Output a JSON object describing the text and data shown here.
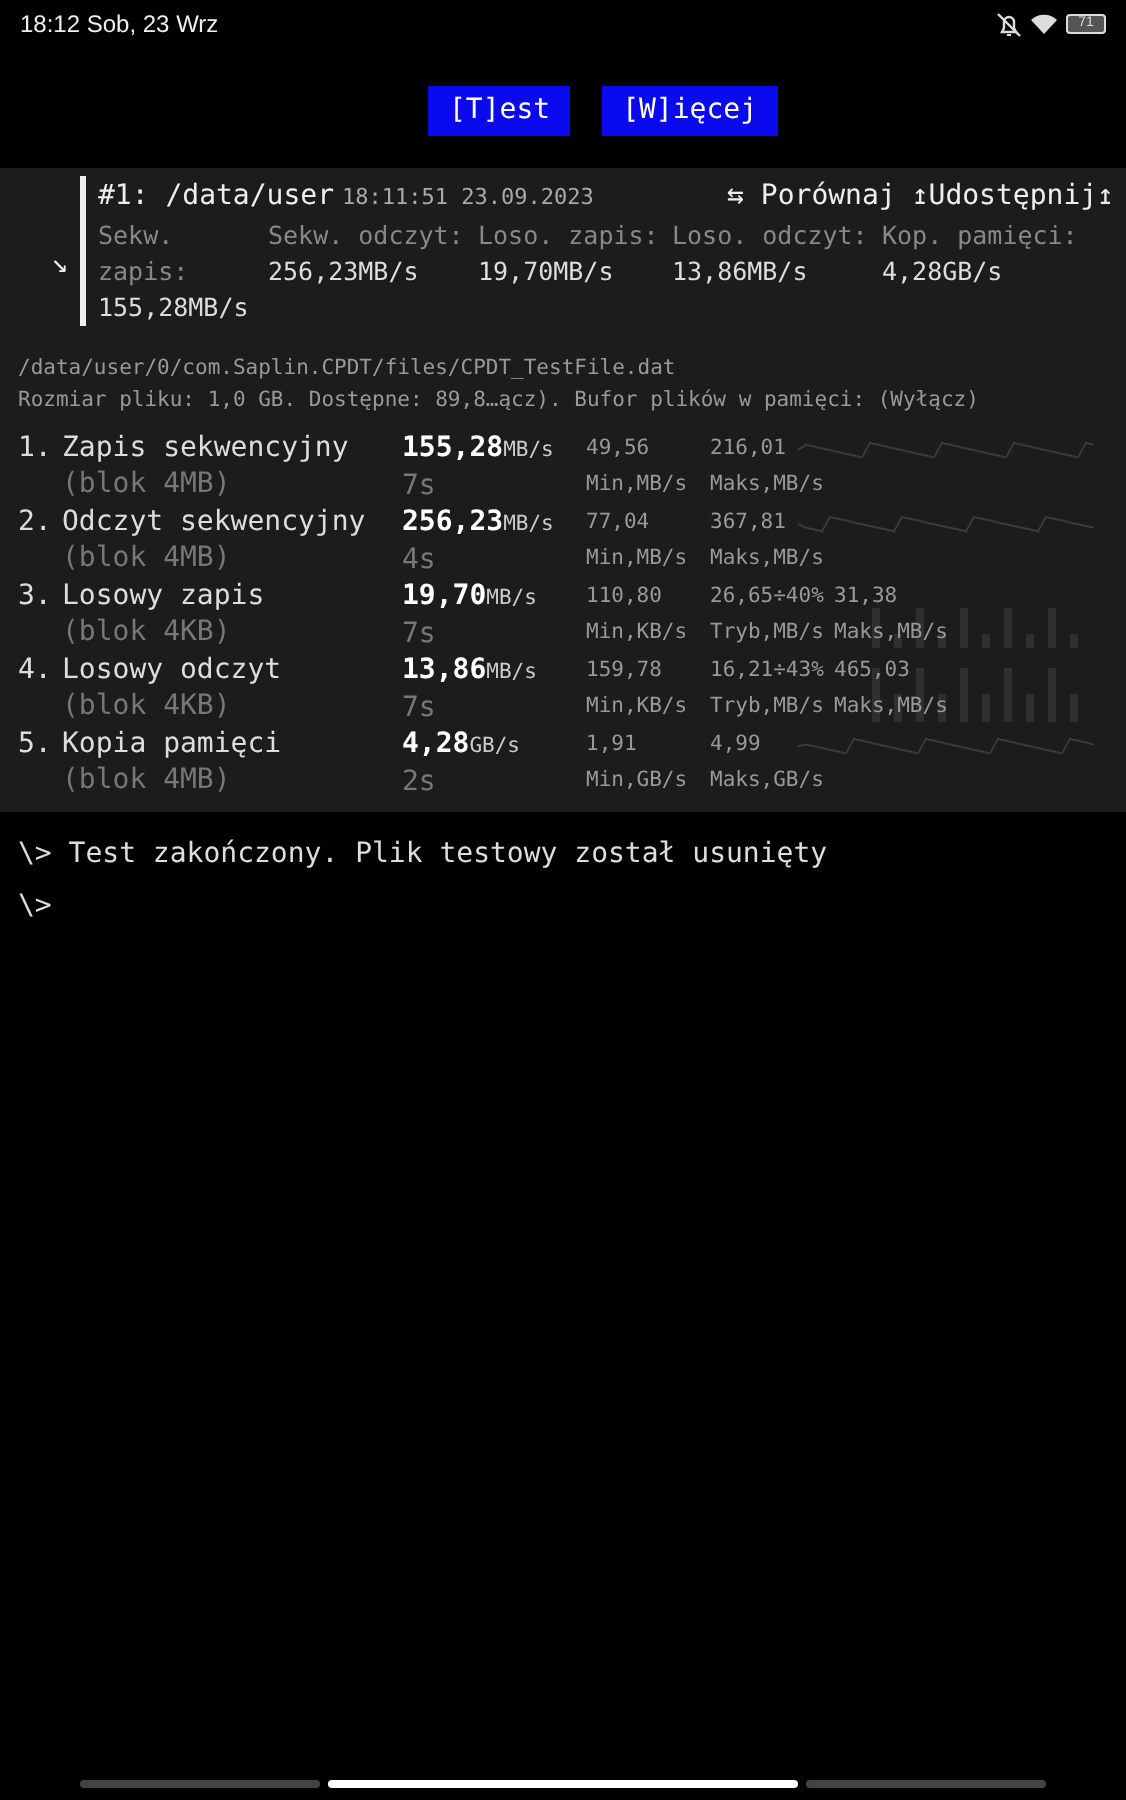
{
  "status_bar": {
    "time": "18:12 Sob, 23 Wrz",
    "battery": "71"
  },
  "buttons": [
    "[T]est",
    "[W]ięcej"
  ],
  "result": {
    "expand": "↘",
    "title": "#1: /data/user",
    "timestamp": "18:11:51 23.09.2023",
    "compare": "⇆ Porównaj",
    "share": "↥Udostępnij↥",
    "metrics": [
      {
        "label": "Sekw. zapis:",
        "value": "155,28MB/s"
      },
      {
        "label": "Sekw. odczyt:",
        "value": "256,23MB/s"
      },
      {
        "label": "Loso. zapis:",
        "value": "19,70MB/s"
      },
      {
        "label": "Loso. odczyt:",
        "value": "13,86MB/s"
      },
      {
        "label": "Kop. pamięci:",
        "value": "4,28GB/s"
      }
    ]
  },
  "file_path": "/data/user/0/com.Saplin.CPDT/files/CPDT_TestFile.dat",
  "file_info": "Rozmiar pliku: 1,0 GB. Dostępne: 89,8…ącz). Bufor plików w pamięci: (Wyłącz)",
  "tests": [
    {
      "number": "1.",
      "name": "Zapis sekwencyjny",
      "block": "(blok 4MB)",
      "speed": "155,28",
      "unit": "MB/s",
      "time": "7s",
      "kind": "line",
      "stats": [
        {
          "value": "49,56",
          "label": "Min,MB/s"
        },
        {
          "value": "216,01",
          "label": "Maks,MB/s"
        }
      ]
    },
    {
      "number": "2.",
      "name": "Odczyt sekwencyjny",
      "block": "(blok 4MB)",
      "speed": "256,23",
      "unit": "MB/s",
      "time": "4s",
      "kind": "line",
      "stats": [
        {
          "value": "77,04",
          "label": "Min,MB/s"
        },
        {
          "value": "367,81",
          "label": "Maks,MB/s"
        }
      ]
    },
    {
      "number": "3.",
      "name": "Losowy zapis",
      "block": "(blok 4KB)",
      "speed": "19,70",
      "unit": "MB/s",
      "time": "7s",
      "kind": "bars",
      "stats": [
        {
          "value": "110,80",
          "label": "Min,KB/s"
        },
        {
          "value": "26,65÷40%",
          "label": "Tryb,MB/s"
        },
        {
          "value": "31,38",
          "label": "Maks,MB/s"
        }
      ]
    },
    {
      "number": "4.",
      "name": "Losowy odczyt",
      "block": "(blok 4KB)",
      "speed": "13,86",
      "unit": "MB/s",
      "time": "7s",
      "kind": "bars",
      "stats": [
        {
          "value": "159,78",
          "label": "Min,KB/s"
        },
        {
          "value": "16,21÷43%",
          "label": "Tryb,MB/s"
        },
        {
          "value": "465,03",
          "label": "Maks,MB/s"
        }
      ]
    },
    {
      "number": "5.",
      "name": "Kopia pamięci",
      "block": "(blok 4MB)",
      "speed": "4,28",
      "unit": "GB/s",
      "time": "2s",
      "kind": "line",
      "stats": [
        {
          "value": "1,91",
          "label": "Min,GB/s"
        },
        {
          "value": "4,99",
          "label": "Maks,GB/s"
        }
      ]
    }
  ],
  "console": [
    "\\> Test zakończony. Plik testowy został usunięty",
    "\\>"
  ]
}
